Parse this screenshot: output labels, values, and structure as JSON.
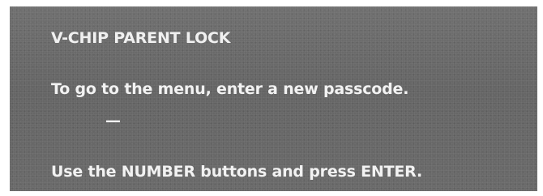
{
  "osd": {
    "title": "V-CHIP PARENT LOCK",
    "prompt": "To go to the menu, enter a new passcode.",
    "passcode_entry": "—",
    "instructions": "Use the NUMBER buttons and press ENTER."
  }
}
